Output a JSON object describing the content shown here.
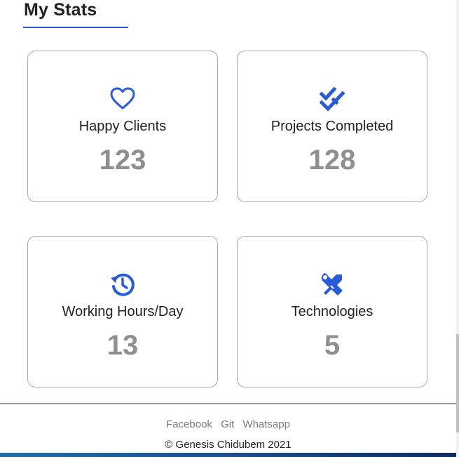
{
  "section": {
    "title": "My Stats",
    "accent_color": "#2a5bd7"
  },
  "stats": [
    {
      "label": "Happy Clients",
      "value": "123",
      "icon": "heart-icon"
    },
    {
      "label": "Projects Completed",
      "value": "128",
      "icon": "double-check-icon"
    },
    {
      "label": "Working Hours/Day",
      "value": "13",
      "icon": "history-icon"
    },
    {
      "label": "Technologies",
      "value": "5",
      "icon": "tools-icon"
    }
  ],
  "footer": {
    "links": [
      "Facebook",
      "Git",
      "Whatsapp"
    ],
    "copyright": "© Genesis Chidubem 2021"
  },
  "colors": {
    "icon": "#2a5bd7",
    "value_text": "#8f8f8f",
    "card_border": "#a9a9a9"
  }
}
